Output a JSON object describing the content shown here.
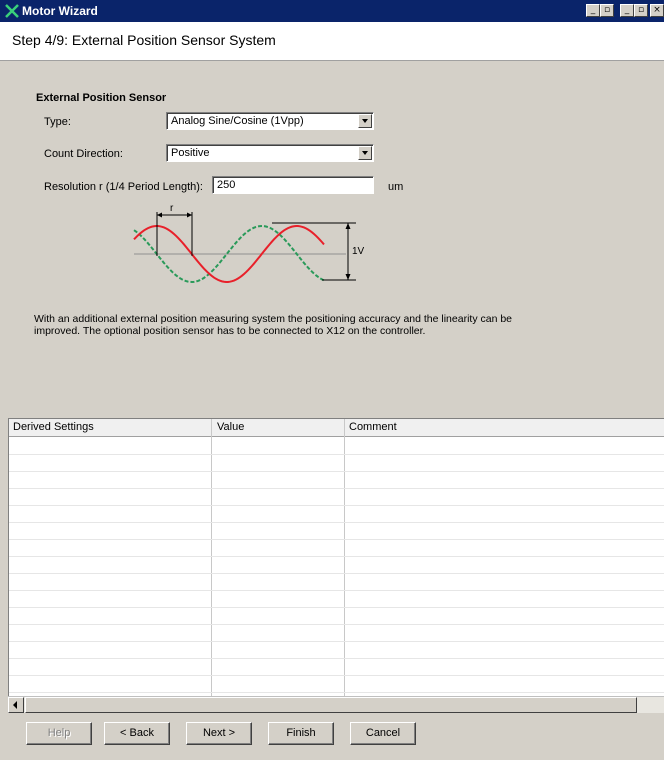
{
  "window": {
    "title": "Motor Wizard",
    "controls": [
      "◾",
      "□",
      "◾",
      "□",
      "×"
    ]
  },
  "header": {
    "step_title": "Step 4/9: External Position Sensor System"
  },
  "form": {
    "section_title": "External Position Sensor",
    "type_label": "Type:",
    "type_value": "Analog Sine/Cosine (1Vpp)",
    "count_direction_label": "Count Direction:",
    "count_direction_value": "Positive",
    "resolution_label": "Resolution r (1/4 Period Length):",
    "resolution_value": "250",
    "resolution_unit": "um"
  },
  "diagram": {
    "r_label": "r",
    "amplitude_label": "1V",
    "sine_color": "#e8202a",
    "cosine_color": "#2a9a5a"
  },
  "description": "With an additional external position measuring system the positioning accuracy and the linearity can be improved. The optional position sensor has to be connected to X12 on the controller.",
  "table": {
    "columns": [
      "Derived Settings",
      "Value",
      "Comment"
    ],
    "rows": []
  },
  "buttons": {
    "help": "Help",
    "back": "< Back",
    "next": "Next >",
    "finish": "Finish",
    "cancel": "Cancel"
  }
}
